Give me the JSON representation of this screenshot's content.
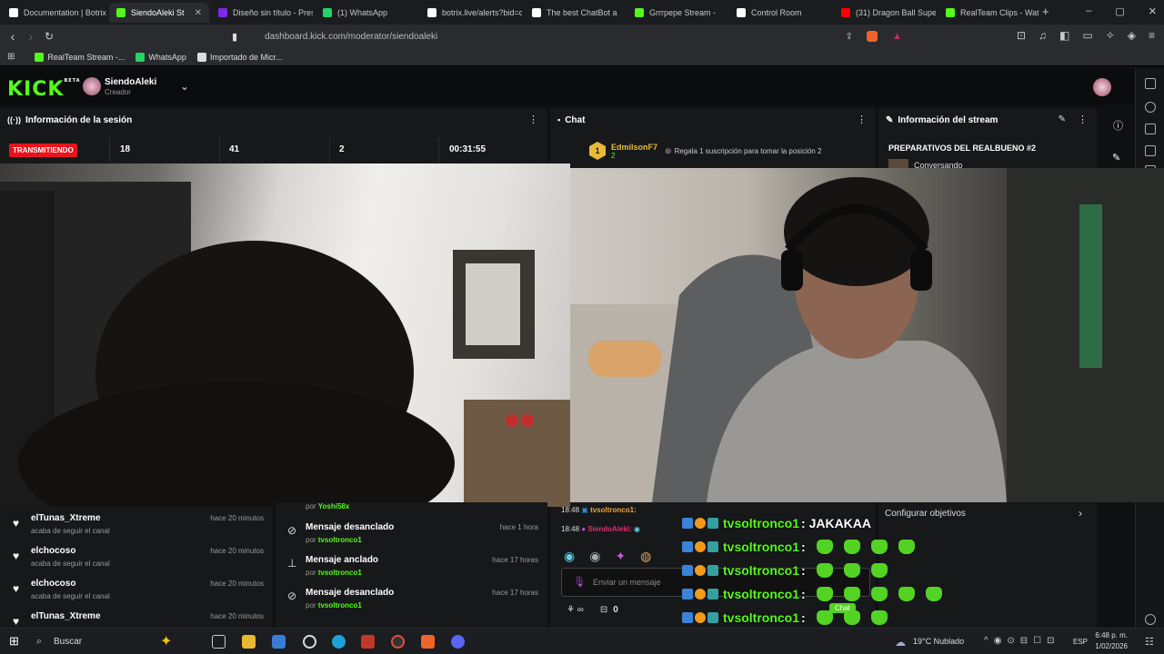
{
  "browser": {
    "tabs": [
      {
        "label": "Documentation | Botrix",
        "color": "#ffffff"
      },
      {
        "label": "SiendoAleki St",
        "color": "#53fc18",
        "active": true
      },
      {
        "label": "Diseño sin título - Pres",
        "color": "#7d2ae8"
      },
      {
        "label": "(1) WhatsApp",
        "color": "#25d366"
      },
      {
        "label": "botrix.live/alerts?bid=o",
        "color": "#ffffff"
      },
      {
        "label": "The best ChatBot a",
        "color": "#ffffff"
      },
      {
        "label": "Grrrpepe Stream -",
        "color": "#53fc18"
      },
      {
        "label": "Control Room",
        "color": "#ffffff"
      },
      {
        "label": "(31) Dragon Ball Super",
        "color": "#ff0000"
      },
      {
        "label": "RealTeam Clips - Watc",
        "color": "#53fc18"
      }
    ],
    "new_tab": "+",
    "url": "dashboard.kick.com/moderator/siendoaleki",
    "bookmarks": [
      {
        "label": "RealTeam Stream -...",
        "color": "#53fc18"
      },
      {
        "label": "WhatsApp",
        "color": "#25d366"
      },
      {
        "label": "Importado de Micr...",
        "color": "#dddddd"
      }
    ]
  },
  "header": {
    "logo": "KICK",
    "logo_tag": "BETA",
    "username": "SiendoAleki",
    "role": "Creador"
  },
  "session": {
    "title": "Información de la sesión",
    "status": "TRANSMITIENDO",
    "stats": [
      "18",
      "41",
      "2",
      "00:31:55"
    ]
  },
  "chat": {
    "title": "Chat",
    "gifter": {
      "rank": "1",
      "name": "EdmilsonF7",
      "count": "2"
    },
    "gift_prompt": "Regala 1 suscripción para tomar la posición 2",
    "msgs": [
      {
        "time": "18:48",
        "user": "tvsoltronco1:",
        "color": "#f0a23a"
      },
      {
        "time": "18:48",
        "user": "SiendoAleki:",
        "color": "#d6336c"
      }
    ],
    "input_placeholder": "Enviar un mensaje",
    "viewer_count": "0"
  },
  "stream_info": {
    "title": "Información del stream",
    "stream_title": "PREPARATIVOS DEL REALBUENO #2",
    "category": "Conversando",
    "goals": "Configurar objetivos"
  },
  "followers": [
    {
      "name": "elTunas_Xtreme",
      "sub": "acaba de seguir el canal",
      "time": "hace 20 minutos"
    },
    {
      "name": "elchocoso",
      "sub": "acaba de seguir el canal",
      "time": "hace 20 minutos"
    },
    {
      "name": "elchocoso",
      "sub": "acaba de seguir el canal",
      "time": "hace 20 minutos"
    },
    {
      "name": "elTunas_Xtreme",
      "sub": "",
      "time": "hace 20 minutos"
    }
  ],
  "mod_log": {
    "partial": {
      "sub": "por",
      "user": "Yoshi58x"
    },
    "items": [
      {
        "title": "Mensaje desanclado",
        "by": "tvsoltronco1",
        "time": "hace 1 hora",
        "icon": "unpin"
      },
      {
        "title": "Mensaje anclado",
        "by": "tvsoltronco1",
        "time": "hace 17 horas",
        "icon": "pin"
      },
      {
        "title": "Mensaje desanclado",
        "by": "tvsoltronco1",
        "time": "hace 17 horas",
        "icon": "unpin"
      }
    ],
    "by_prefix": "por"
  },
  "overlay_chat": [
    {
      "user": "tvsoltronco1",
      "msg": ": JAKAKAA",
      "emotes": 0
    },
    {
      "user": "tvsoltronco1",
      "msg": ":",
      "emotes": 4
    },
    {
      "user": "tvsoltronco1",
      "msg": ":",
      "emotes": 3
    },
    {
      "user": "tvsoltronco1",
      "msg": ":",
      "emotes": 5
    },
    {
      "user": "tvsoltronco1",
      "msg": ":",
      "emotes": 3
    }
  ],
  "overlay_badge": "Chat",
  "taskbar": {
    "search": "Buscar",
    "weather": "19°C  Nublado",
    "lang": "ESP",
    "time": "6:48 p. m.",
    "date": "1/02/2026"
  }
}
